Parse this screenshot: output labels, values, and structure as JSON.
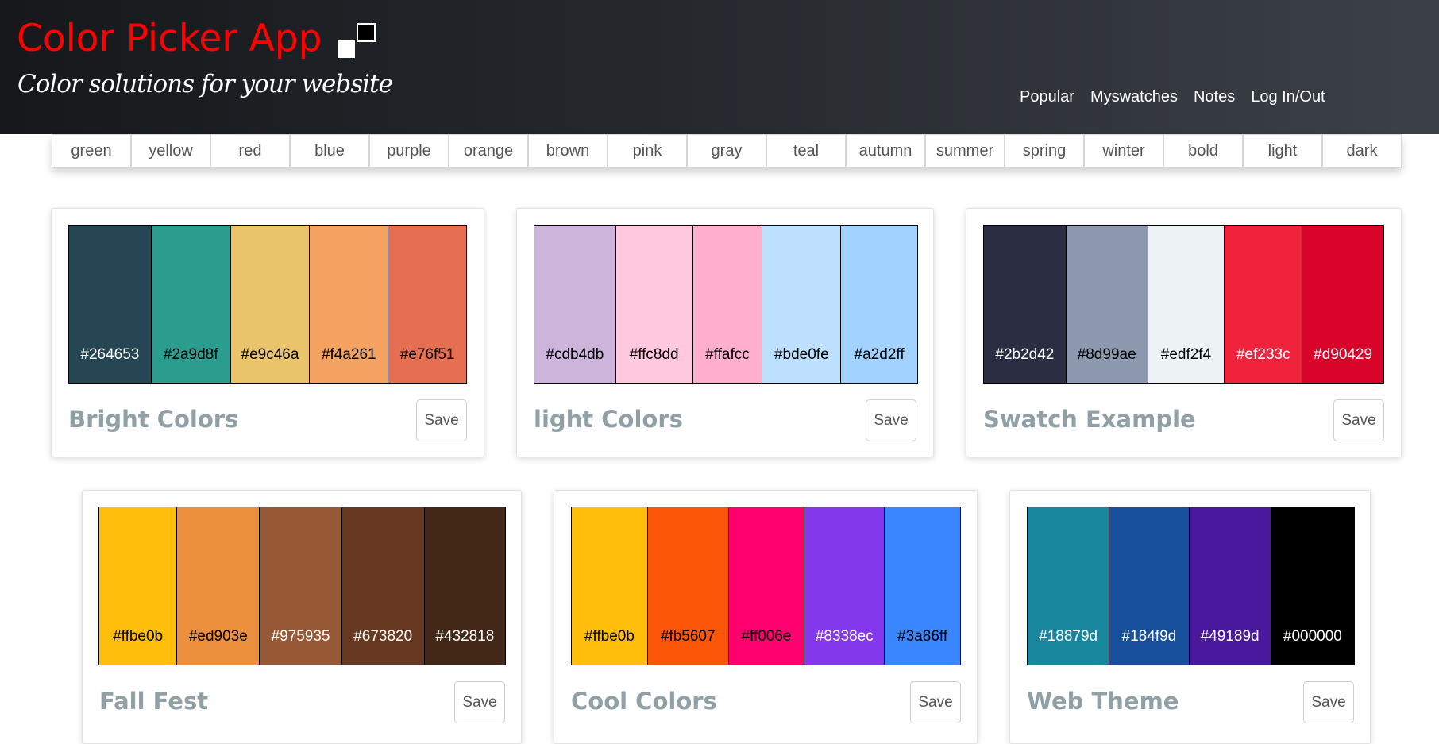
{
  "header": {
    "title": "Color Picker App",
    "tagline": "Color solutions for your website",
    "nav": [
      "Popular",
      "Myswatches",
      "Notes",
      "Log In/Out"
    ]
  },
  "filters": [
    "green",
    "yellow",
    "red",
    "blue",
    "purple",
    "orange",
    "brown",
    "pink",
    "gray",
    "teal",
    "autumn",
    "summer",
    "spring",
    "winter",
    "bold",
    "light",
    "dark"
  ],
  "palettes": [
    {
      "title": "Bright Colors",
      "save": "Save",
      "colors": [
        {
          "hex": "#264653",
          "text": "#ffffff"
        },
        {
          "hex": "#2a9d8f",
          "text": "#000000"
        },
        {
          "hex": "#e9c46a",
          "text": "#000000"
        },
        {
          "hex": "#f4a261",
          "text": "#000000"
        },
        {
          "hex": "#e76f51",
          "text": "#000000"
        }
      ]
    },
    {
      "title": "light Colors",
      "save": "Save",
      "colors": [
        {
          "hex": "#cdb4db",
          "text": "#000000"
        },
        {
          "hex": "#ffc8dd",
          "text": "#000000"
        },
        {
          "hex": "#ffafcc",
          "text": "#000000"
        },
        {
          "hex": "#bde0fe",
          "text": "#000000"
        },
        {
          "hex": "#a2d2ff",
          "text": "#000000"
        }
      ]
    },
    {
      "title": "Swatch Example",
      "save": "Save",
      "colors": [
        {
          "hex": "#2b2d42",
          "text": "#ffffff"
        },
        {
          "hex": "#8d99ae",
          "text": "#000000"
        },
        {
          "hex": "#edf2f4",
          "text": "#000000"
        },
        {
          "hex": "#ef233c",
          "text": "#ffffff"
        },
        {
          "hex": "#d90429",
          "text": "#ffffff"
        }
      ]
    },
    {
      "title": "Fall Fest",
      "save": "Save",
      "colors": [
        {
          "hex": "#ffbe0b",
          "text": "#000000"
        },
        {
          "hex": "#ed903e",
          "text": "#000000"
        },
        {
          "hex": "#975935",
          "text": "#ffffff"
        },
        {
          "hex": "#673820",
          "text": "#ffffff"
        },
        {
          "hex": "#432818",
          "text": "#ffffff"
        }
      ]
    },
    {
      "title": "Cool Colors",
      "save": "Save",
      "colors": [
        {
          "hex": "#ffbe0b",
          "text": "#000000"
        },
        {
          "hex": "#fb5607",
          "text": "#000000"
        },
        {
          "hex": "#ff006e",
          "text": "#000000"
        },
        {
          "hex": "#8338ec",
          "text": "#ffffff"
        },
        {
          "hex": "#3a86ff",
          "text": "#000000"
        }
      ]
    },
    {
      "title": "Web Theme",
      "save": "Save",
      "colors": [
        {
          "hex": "#18879d",
          "text": "#ffffff"
        },
        {
          "hex": "#184f9d",
          "text": "#ffffff"
        },
        {
          "hex": "#49189d",
          "text": "#ffffff"
        },
        {
          "hex": "#000000",
          "text": "#ffffff"
        }
      ]
    }
  ]
}
